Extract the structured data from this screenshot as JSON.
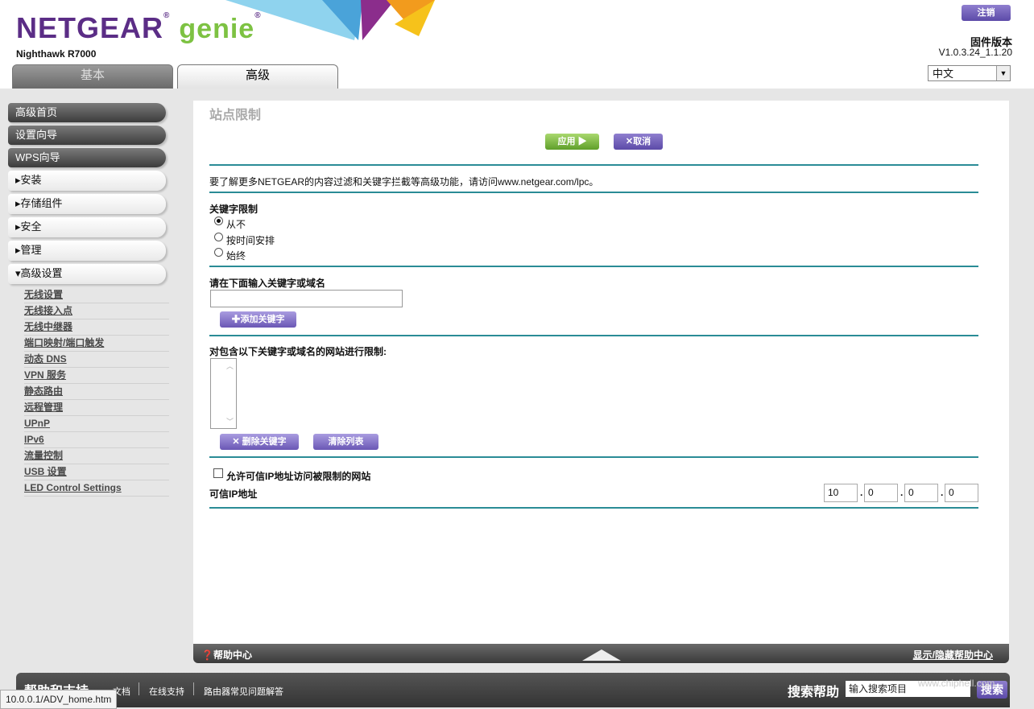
{
  "header": {
    "brand_netgear": "NETGEAR",
    "brand_genie": "genie",
    "model": "Nighthawk R7000",
    "logout_label": "注销",
    "firmware_label": "固件版本",
    "firmware_version": "V1.0.3.24_1.1.20",
    "language": "中文"
  },
  "tabs": [
    {
      "label": "基本",
      "active": false
    },
    {
      "label": "高级",
      "active": true
    }
  ],
  "sidebar": {
    "main_items": [
      "高级首页",
      "设置向导",
      "WPS向导"
    ],
    "groups": [
      "▸安装",
      "▸存储组件",
      "▸安全",
      "▸管理",
      "▾高级设置"
    ],
    "sub_items": [
      "无线设置",
      "无线接入点",
      "无线中继器",
      "端口映射/端口触发",
      "动态 DNS",
      "VPN 服务",
      "静态路由",
      "远程管理",
      "UPnP",
      "IPv6",
      "流量控制",
      "USB 设置",
      "LED Control Settings"
    ]
  },
  "main": {
    "title": "站点限制",
    "apply_label": "应用 ▶",
    "cancel_label": "✕取消",
    "info_text": "要了解更多NETGEAR的内容过滤和关键字拦截等高级功能，请访问www.netgear.com/lpc。",
    "keyword_heading": "关键字限制",
    "radio_options": [
      "从不",
      "按时间安排",
      "始终"
    ],
    "selected_option": "从不",
    "input_heading": "请在下面输入关键字或域名",
    "add_keyword_label": "✚添加关键字",
    "list_heading": "对包含以下关键字或域名的网站进行限制:",
    "delete_keyword_label": "✕ 删除关键字",
    "clear_list_label": "清除列表",
    "trusted_checkbox_label": "允许可信IP地址访问被限制的网站",
    "trusted_ip_label": "可信IP地址",
    "ip": [
      "10",
      "0",
      "0",
      "0"
    ]
  },
  "helpbar": {
    "help_center": "帮助中心",
    "show_hide": "显示/隐藏帮助中心"
  },
  "footer": {
    "title": "帮助和支持",
    "links": [
      "文档",
      "在线支持",
      "路由器常见问题解答"
    ],
    "search_label": "搜索帮助",
    "search_placeholder": "输入搜索项目",
    "search_button": "搜索"
  },
  "statusbar": "10.0.0.1/ADV_home.htm",
  "watermark": "www.chiphell.com"
}
